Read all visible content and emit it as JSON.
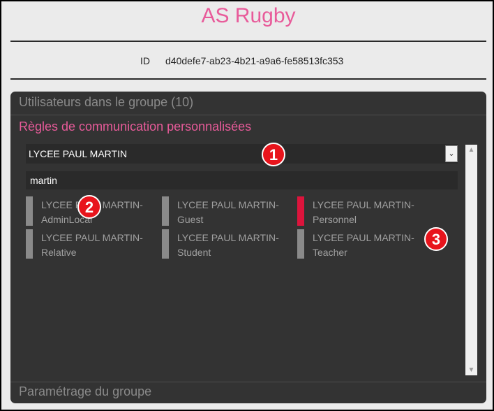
{
  "header": {
    "title": "AS Rugby"
  },
  "identity": {
    "id_label": "ID",
    "id_value": "d40defe7-ab23-4b21-a9a6-fe58513fc353"
  },
  "panel": {
    "users_section": "Utilisateurs dans le groupe (10)",
    "rules_section": "Règles de communication personnalisées",
    "settings_section": "Paramétrage du groupe",
    "school_select": {
      "value": "LYCEE PAUL MARTIN",
      "arrow": "⌄"
    },
    "search": {
      "value": "martin"
    },
    "groups": [
      {
        "label": "LYCEE PAUL MARTIN-AdminLocal",
        "selected": false
      },
      {
        "label": "LYCEE PAUL MARTIN-Guest",
        "selected": false
      },
      {
        "label": "LYCEE PAUL MARTIN-Personnel",
        "selected": true
      },
      {
        "label": "LYCEE PAUL MARTIN-Relative",
        "selected": false
      },
      {
        "label": "LYCEE PAUL MARTIN-Student",
        "selected": false
      },
      {
        "label": "LYCEE PAUL MARTIN-Teacher",
        "selected": false
      }
    ]
  },
  "badges": [
    "1",
    "2",
    "3"
  ],
  "colors": {
    "accent": "#e85b9a",
    "selected_bar": "#dc143c",
    "badge": "#e8141c"
  }
}
